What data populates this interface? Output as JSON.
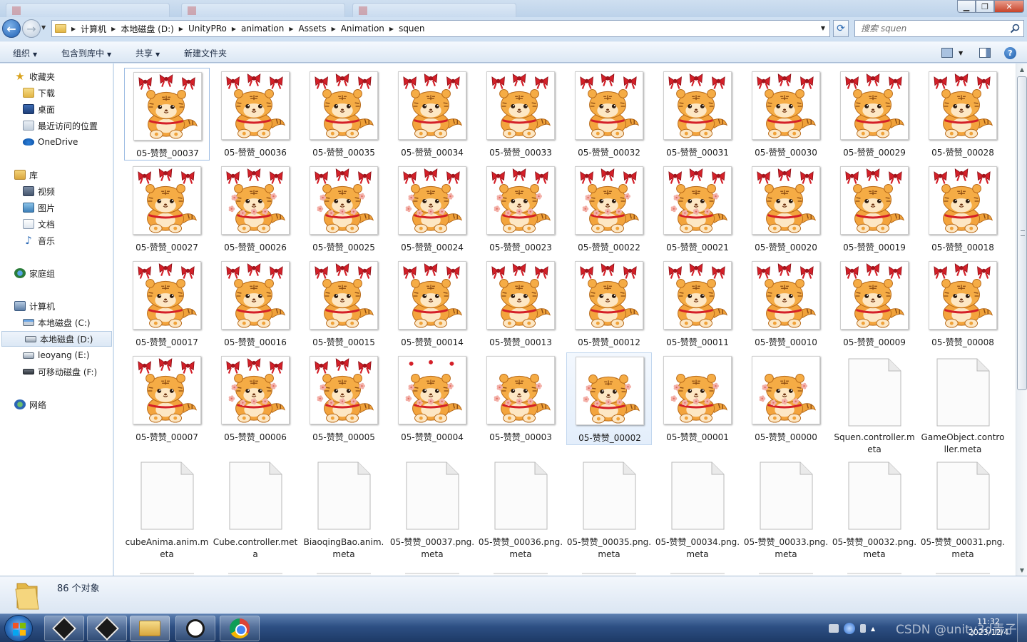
{
  "window": {
    "minimize_glyph": "▁",
    "maximize_glyph": "❐",
    "close_glyph": "✕"
  },
  "address": {
    "crumbs": [
      "计算机",
      "本地磁盘 (D:)",
      "UnityPRo",
      "animation",
      "Assets",
      "Animation",
      "squen"
    ],
    "search_placeholder": "搜索 squen"
  },
  "toolbar": {
    "organize": "组织",
    "include_library": "包含到库中",
    "share": "共享",
    "new_folder": "新建文件夹"
  },
  "sidebar": {
    "items": [
      {
        "label": "收藏夹",
        "icon": "star-icon"
      },
      {
        "label": "下载",
        "icon": "downloads-folder-icon"
      },
      {
        "label": "桌面",
        "icon": "desktop-icon"
      },
      {
        "label": "最近访问的位置",
        "icon": "recent-places-icon"
      },
      {
        "label": "OneDrive",
        "icon": "onedrive-icon"
      },
      {
        "label": "库",
        "icon": "library-icon"
      },
      {
        "label": "视频",
        "icon": "videos-icon"
      },
      {
        "label": "图片",
        "icon": "pictures-icon"
      },
      {
        "label": "文档",
        "icon": "documents-icon"
      },
      {
        "label": "音乐",
        "icon": "music-icon"
      },
      {
        "label": "家庭组",
        "icon": "homegroup-icon"
      },
      {
        "label": "计算机",
        "icon": "computer-icon"
      },
      {
        "label": "本地磁盘 (C:)",
        "icon": "drive-c-icon"
      },
      {
        "label": "本地磁盘 (D:)",
        "icon": "drive-d-icon",
        "selected": true
      },
      {
        "label": "leoyang (E:)",
        "icon": "drive-e-icon"
      },
      {
        "label": "可移动磁盘 (F:)",
        "icon": "removable-drive-icon"
      },
      {
        "label": "网络",
        "icon": "network-icon"
      }
    ]
  },
  "files": [
    {
      "label": "05-赞赞_00037",
      "type": "png",
      "variant": "bows"
    },
    {
      "label": "05-赞赞_00036",
      "type": "png",
      "variant": "bows"
    },
    {
      "label": "05-赞赞_00035",
      "type": "png",
      "variant": "bows"
    },
    {
      "label": "05-赞赞_00034",
      "type": "png",
      "variant": "bows"
    },
    {
      "label": "05-赞赞_00033",
      "type": "png",
      "variant": "bows"
    },
    {
      "label": "05-赞赞_00032",
      "type": "png",
      "variant": "bows"
    },
    {
      "label": "05-赞赞_00031",
      "type": "png",
      "variant": "bows"
    },
    {
      "label": "05-赞赞_00030",
      "type": "png",
      "variant": "bows"
    },
    {
      "label": "05-赞赞_00029",
      "type": "png",
      "variant": "bows"
    },
    {
      "label": "05-赞赞_00028",
      "type": "png",
      "variant": "bows"
    },
    {
      "label": "05-赞赞_00027",
      "type": "png",
      "variant": "bows"
    },
    {
      "label": "05-赞赞_00026",
      "type": "png",
      "variant": "bows-flowers"
    },
    {
      "label": "05-赞赞_00025",
      "type": "png",
      "variant": "bows-flowers"
    },
    {
      "label": "05-赞赞_00024",
      "type": "png",
      "variant": "bows-flowers"
    },
    {
      "label": "05-赞赞_00023",
      "type": "png",
      "variant": "bows-flowers"
    },
    {
      "label": "05-赞赞_00022",
      "type": "png",
      "variant": "bows-flowers"
    },
    {
      "label": "05-赞赞_00021",
      "type": "png",
      "variant": "bows-flowers"
    },
    {
      "label": "05-赞赞_00020",
      "type": "png",
      "variant": "bows"
    },
    {
      "label": "05-赞赞_00019",
      "type": "png",
      "variant": "bows"
    },
    {
      "label": "05-赞赞_00018",
      "type": "png",
      "variant": "bows"
    },
    {
      "label": "05-赞赞_00017",
      "type": "png",
      "variant": "bows"
    },
    {
      "label": "05-赞赞_00016",
      "type": "png",
      "variant": "bows"
    },
    {
      "label": "05-赞赞_00015",
      "type": "png",
      "variant": "bows"
    },
    {
      "label": "05-赞赞_00014",
      "type": "png",
      "variant": "bows"
    },
    {
      "label": "05-赞赞_00013",
      "type": "png",
      "variant": "bows"
    },
    {
      "label": "05-赞赞_00012",
      "type": "png",
      "variant": "bows"
    },
    {
      "label": "05-赞赞_00011",
      "type": "png",
      "variant": "bows"
    },
    {
      "label": "05-赞赞_00010",
      "type": "png",
      "variant": "bows"
    },
    {
      "label": "05-赞赞_00009",
      "type": "png",
      "variant": "bows"
    },
    {
      "label": "05-赞赞_00008",
      "type": "png",
      "variant": "bows"
    },
    {
      "label": "05-赞赞_00007",
      "type": "png",
      "variant": "bows"
    },
    {
      "label": "05-赞赞_00006",
      "type": "png",
      "variant": "bows-flowers"
    },
    {
      "label": "05-赞赞_00005",
      "type": "png",
      "variant": "bows-flowers"
    },
    {
      "label": "05-赞赞_00004",
      "type": "png",
      "variant": "small-bows-flowers"
    },
    {
      "label": "05-赞赞_00003",
      "type": "png",
      "variant": "flowers"
    },
    {
      "label": "05-赞赞_00002",
      "type": "png",
      "variant": "flowers",
      "selected": true
    },
    {
      "label": "05-赞赞_00001",
      "type": "png",
      "variant": "flowers"
    },
    {
      "label": "05-赞赞_00000",
      "type": "png",
      "variant": "flowers"
    },
    {
      "label": "Squen.controller.meta",
      "type": "doc"
    },
    {
      "label": "GameObject.controller.meta",
      "type": "doc"
    },
    {
      "label": "cubeAnima.anim.meta",
      "type": "doc"
    },
    {
      "label": "Cube.controller.meta",
      "type": "doc"
    },
    {
      "label": "BiaoqingBao.anim.meta",
      "type": "doc"
    },
    {
      "label": "05-赞赞_00037.png.meta",
      "type": "doc"
    },
    {
      "label": "05-赞赞_00036.png.meta",
      "type": "doc"
    },
    {
      "label": "05-赞赞_00035.png.meta",
      "type": "doc"
    },
    {
      "label": "05-赞赞_00034.png.meta",
      "type": "doc"
    },
    {
      "label": "05-赞赞_00033.png.meta",
      "type": "doc"
    },
    {
      "label": "05-赞赞_00032.png.meta",
      "type": "doc"
    },
    {
      "label": "05-赞赞_00031.png.meta",
      "type": "doc"
    }
  ],
  "status": {
    "count_text": "86 个对象"
  },
  "taskbar": {
    "apps": [
      {
        "name": "unity-hub-icon"
      },
      {
        "name": "unity-editor-icon"
      },
      {
        "name": "file-explorer-icon",
        "active": true
      },
      {
        "name": "pinwheel-app-icon"
      },
      {
        "name": "chrome-icon"
      }
    ],
    "watermark": "CSDN @unity3d青子",
    "time": "11:32",
    "date": "2023/12/4"
  },
  "colors": {
    "accent": "#2b6fbd",
    "selection": "#e3eefb",
    "tiger_orange": "#f0a23a",
    "bow_red": "#d41f28"
  }
}
